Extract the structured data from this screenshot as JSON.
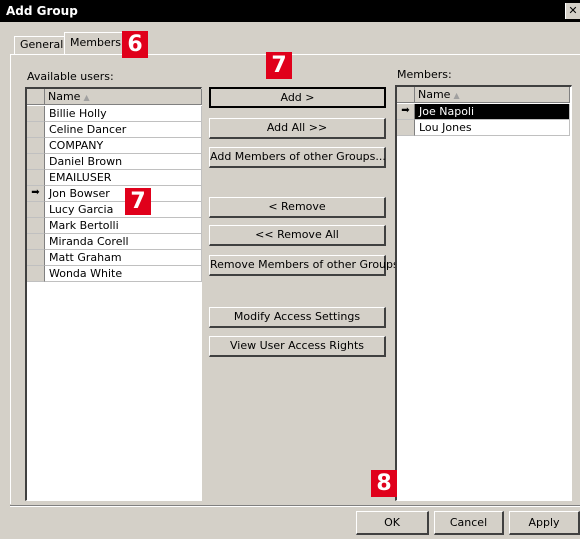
{
  "window": {
    "title": "Add Group",
    "close_glyph": "✕"
  },
  "tabs": [
    {
      "label": "General",
      "active": false
    },
    {
      "label": "Members",
      "active": true
    }
  ],
  "badges": {
    "tabs": "6",
    "add": "7",
    "list": "7",
    "ok": "8"
  },
  "available": {
    "label": "Available users:",
    "column": "Name",
    "sort_glyph": "▲",
    "current_row_glyph": "➡",
    "current_index": 5,
    "users": [
      "Billie Holly",
      "Celine Dancer",
      "COMPANY",
      "Daniel Brown",
      "EMAILUSER",
      "Jon Bowser",
      "Lucy Garcia",
      "Mark Bertolli",
      "Miranda Corell",
      "Matt Graham",
      "Wonda White"
    ]
  },
  "members": {
    "label": "Members:",
    "column": "Name",
    "sort_glyph": "▲",
    "current_row_glyph": "➡",
    "selected_index": 0,
    "users": [
      "Joe Napoli",
      "Lou Jones"
    ]
  },
  "actions": {
    "add": "Add >",
    "add_all": "Add All >>",
    "add_members_other": "Add Members of other Groups...",
    "remove": "< Remove",
    "remove_all": "<< Remove All",
    "remove_members_other": "Remove Members of other Groups...",
    "modify_access": "Modify Access Settings",
    "view_rights": "View User Access Rights"
  },
  "footer": {
    "ok": "OK",
    "cancel": "Cancel",
    "apply": "Apply"
  },
  "colors": {
    "badge": "#e0001b",
    "selection": "#000000",
    "face": "#d4d0c8"
  }
}
